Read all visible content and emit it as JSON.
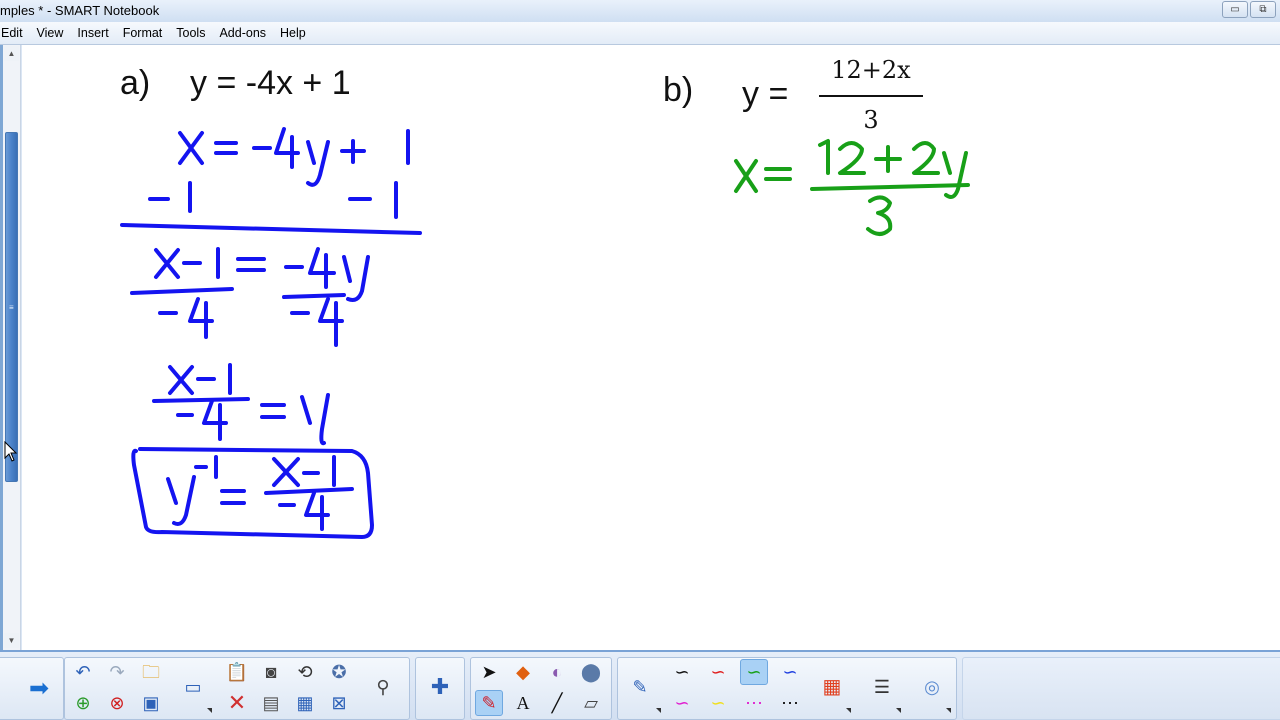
{
  "window": {
    "title": "mples * - SMART Notebook",
    "min_glyph": "▭",
    "max_glyph": "⧉"
  },
  "menu": {
    "items": [
      "Edit",
      "View",
      "Insert",
      "Format",
      "Tools",
      "Add-ons",
      "Help"
    ]
  },
  "page": {
    "part_a": {
      "label": "a)",
      "equation": "y = -4x + 1"
    },
    "part_b": {
      "label": "b)",
      "lhs": "y =",
      "numerator": "12+2x",
      "denominator": "3"
    }
  },
  "ink_colors": {
    "blue": "#1414f0",
    "green": "#18a018"
  },
  "toolbar": {
    "groups": [
      "navigation",
      "file",
      "display",
      "page-tools",
      "drawing",
      "pens",
      "properties"
    ],
    "active_tool": "pens",
    "active_pen": "green-pen"
  }
}
